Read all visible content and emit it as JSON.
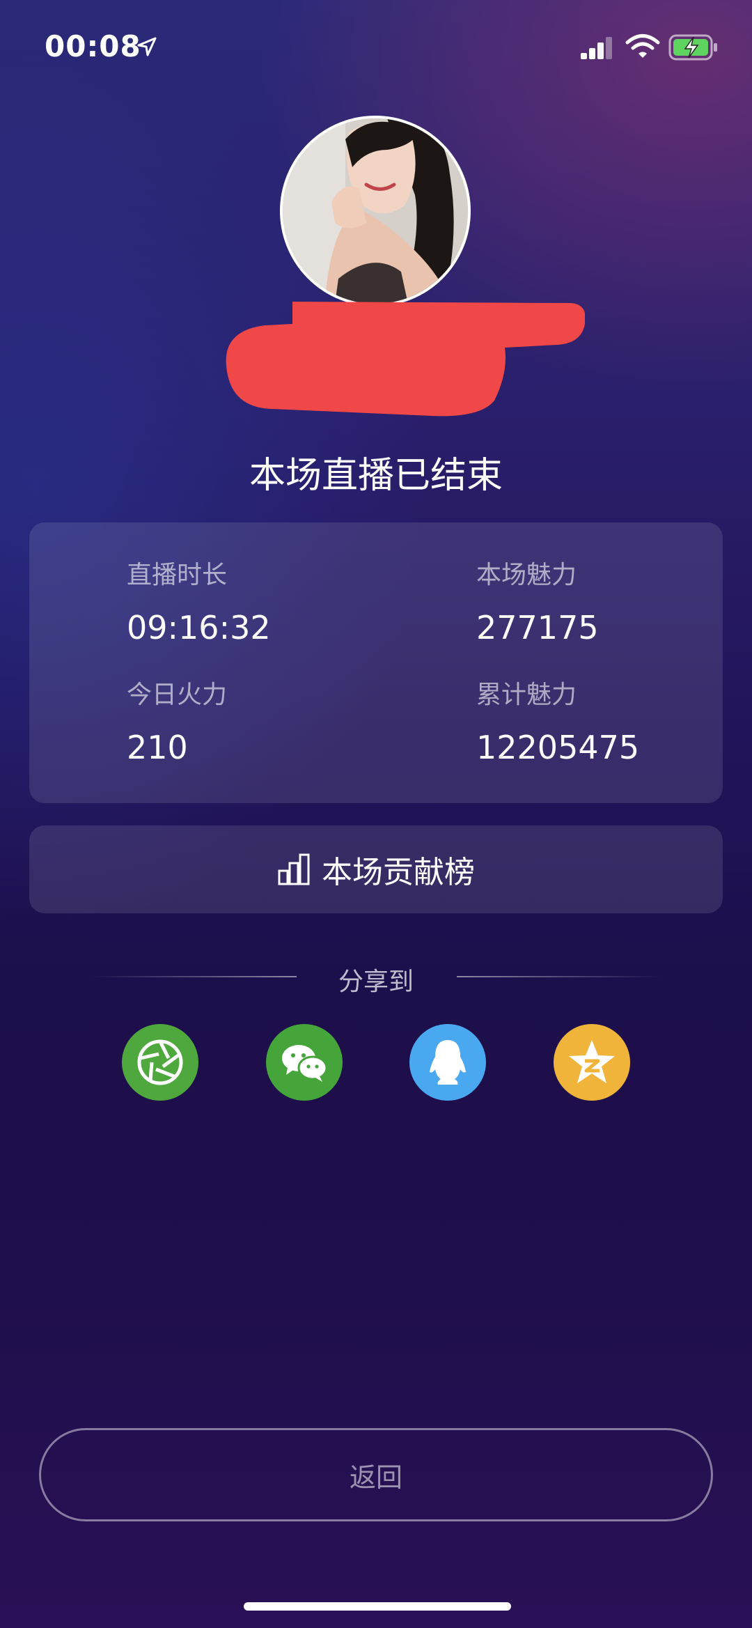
{
  "status_bar": {
    "time": "00:08",
    "icons": [
      "location-arrow-icon",
      "cellular-signal-icon",
      "wifi-icon",
      "battery-charging-icon"
    ]
  },
  "profile": {
    "avatar": "avatar-photo",
    "name_redacted": true
  },
  "title": "本场直播已结束",
  "stats": {
    "duration_label": "直播时长",
    "duration_value": "09:16:32",
    "charm_label": "本场魅力",
    "charm_value": "277175",
    "fire_label": "今日火力",
    "fire_value": "210",
    "total_charm_label": "累计魅力",
    "total_charm_value": "12205475"
  },
  "contribution": {
    "label": "本场贡献榜",
    "icon": "bar-chart-icon"
  },
  "share": {
    "label": "分享到",
    "targets": [
      {
        "name": "moments",
        "icon": "camera-aperture-icon",
        "color": "#4fa83d"
      },
      {
        "name": "wechat",
        "icon": "wechat-icon",
        "color": "#45a43a"
      },
      {
        "name": "qq",
        "icon": "qq-penguin-icon",
        "color": "#4aa8f0"
      },
      {
        "name": "qzone",
        "icon": "qzone-star-icon",
        "color": "#f0b43a"
      }
    ]
  },
  "back_button": "返回",
  "colors": {
    "background_top": "#2a2a78",
    "background_bottom": "#1d0f4b",
    "card_fill": "rgba(255,255,255,0.11)",
    "redaction": "#f04848"
  }
}
